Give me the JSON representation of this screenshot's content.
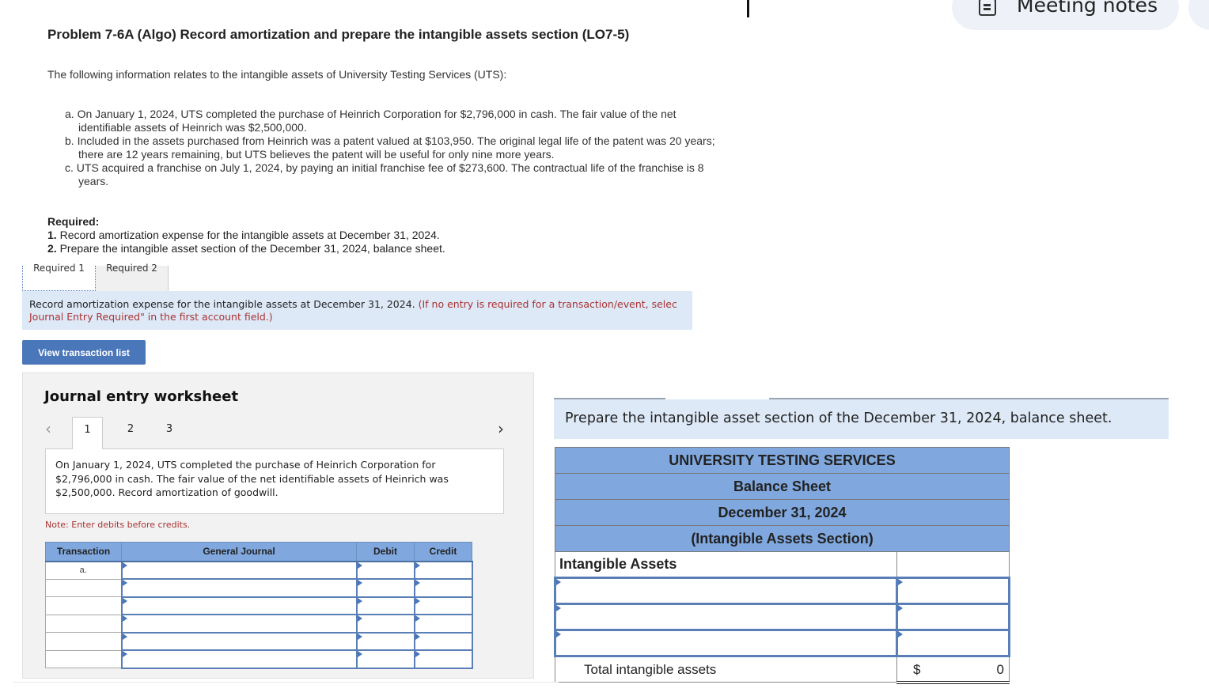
{
  "problem": {
    "title": "Problem 7-6A (Algo) Record amortization and prepare the intangible assets section (LO7-5)",
    "intro": "The following information relates to the intangible assets of University Testing Services (UTS):",
    "items": [
      "a. On January 1, 2024, UTS completed the purchase of Heinrich Corporation for $2,796,000 in cash. The fair value of the net identifiable assets of Heinrich was $2,500,000.",
      "b. Included in the assets purchased from Heinrich was a patent valued at $103,950. The original legal life of the patent was 20 years; there are 12 years remaining, but UTS believes the patent will be useful for only nine more years.",
      "c. UTS acquired a franchise on July 1, 2024, by paying an initial franchise fee of $273,600. The contractual life of the franchise is 8 years."
    ],
    "required_heading": "Required:",
    "required": [
      {
        "num": "1.",
        "text": " Record amortization expense for the intangible assets at December 31, 2024."
      },
      {
        "num": "2.",
        "text": " Prepare the intangible asset section of the December 31, 2024, balance sheet."
      }
    ]
  },
  "tabs": [
    {
      "label": "Required 1",
      "active": true
    },
    {
      "label": "Required 2",
      "active": false
    }
  ],
  "instruction": {
    "text": "Record amortization expense for the intangible assets at December 31, 2024. ",
    "note_line1": "(If no entry is required for a transaction/event, selec",
    "note_line2": "Journal Entry Required\" in the first account field.)"
  },
  "view_transaction_list": "View transaction list",
  "worksheet": {
    "title": "Journal entry worksheet",
    "pages": [
      "1",
      "2",
      "3"
    ],
    "active_page": "1",
    "prev_icon": "‹",
    "next_icon": "›",
    "description": "On January 1, 2024, UTS completed the purchase of Heinrich Corporation for $2,796,000 in cash. The fair value of the net identifiable assets of Heinrich was $2,500,000. Record amortization of goodwill.",
    "note": "Note: Enter debits before credits.",
    "columns": [
      "Transaction",
      "General Journal",
      "Debit",
      "Credit"
    ],
    "rows": [
      {
        "transaction": "a.",
        "account": "",
        "debit": "",
        "credit": ""
      },
      {
        "transaction": "",
        "account": "",
        "debit": "",
        "credit": ""
      },
      {
        "transaction": "",
        "account": "",
        "debit": "",
        "credit": ""
      },
      {
        "transaction": "",
        "account": "",
        "debit": "",
        "credit": ""
      },
      {
        "transaction": "",
        "account": "",
        "debit": "",
        "credit": ""
      },
      {
        "transaction": "",
        "account": "",
        "debit": "",
        "credit": ""
      }
    ]
  },
  "balance_sheet": {
    "instruction": "Prepare the intangible asset section of the December 31, 2024, balance sheet.",
    "company": "UNIVERSITY TESTING SERVICES",
    "statement": "Balance Sheet",
    "date": "December 31, 2024",
    "section": "(Intangible Assets Section)",
    "group_label": "Intangible Assets",
    "rows": [
      {
        "account": "",
        "amount": ""
      },
      {
        "account": "",
        "amount": ""
      },
      {
        "account": "",
        "amount": ""
      }
    ],
    "total_label": "Total intangible assets",
    "total_currency": "$",
    "total_value": "0"
  },
  "overlay": {
    "meeting_notes_label": "Meeting notes"
  },
  "colors": {
    "header_blue": "#80a8de",
    "button_blue": "#4a76ba",
    "instruction_bg": "#dde9f7",
    "note_red": "#aa3333"
  }
}
